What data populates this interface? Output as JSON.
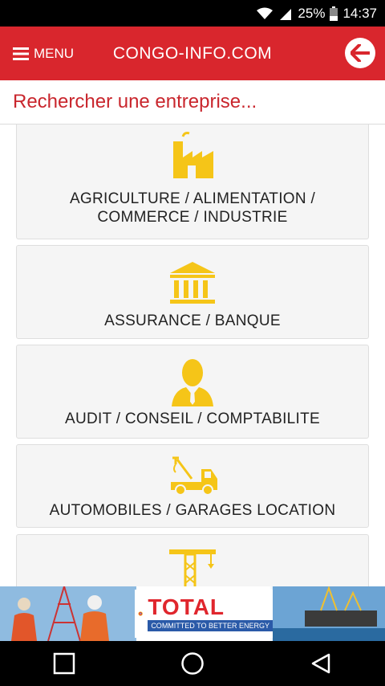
{
  "status": {
    "battery": "25%",
    "time": "14:37"
  },
  "appbar": {
    "menu_label": "MENU",
    "title": "CONGO-INFO.COM"
  },
  "search": {
    "placeholder": "Rechercher une entreprise..."
  },
  "categories": [
    {
      "label_line1": "AGRICULTURE / ALIMENTATION /",
      "label_line2": "COMMERCE / INDUSTRIE",
      "icon": "factory-icon"
    },
    {
      "label": "ASSURANCE / BANQUE",
      "icon": "bank-icon"
    },
    {
      "label": "AUDIT / CONSEIL / COMPTABILITE",
      "icon": "consultant-icon"
    },
    {
      "label": "AUTOMOBILES / GARAGES LOCATION",
      "icon": "tow-truck-icon"
    },
    {
      "label": "",
      "icon": "crane-icon"
    }
  ],
  "ad": {
    "brand": "TOTAL",
    "tagline": "COMMITTED TO BETTER ENERGY"
  },
  "colors": {
    "accent": "#d9262d",
    "icon_yellow": "#f5c518"
  }
}
